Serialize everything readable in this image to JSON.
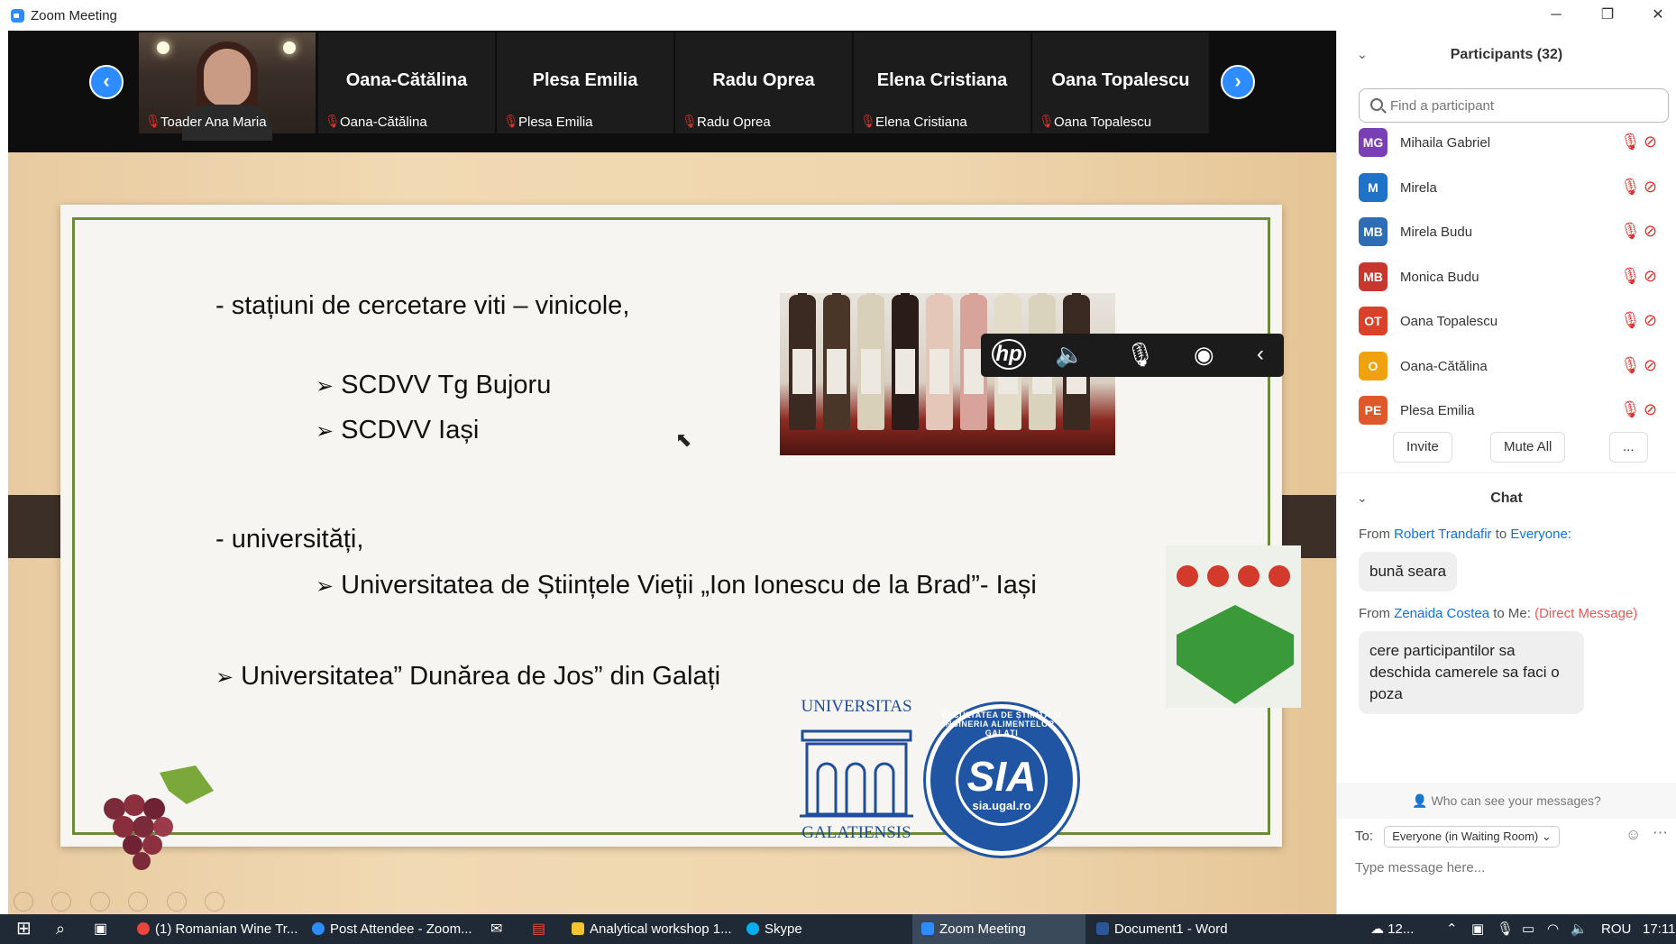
{
  "window": {
    "title": "Zoom Meeting",
    "controls": {
      "minimize": "─",
      "restore": "❐",
      "close": "✕"
    }
  },
  "strip": {
    "prev": "‹",
    "next": "›",
    "tiles": [
      {
        "name": "Toader Ana Maria",
        "big": ""
      },
      {
        "name": "Oana-Cătălina",
        "big": "Oana-Cătălina"
      },
      {
        "name": "Plesa Emilia",
        "big": "Plesa Emilia"
      },
      {
        "name": "Radu Oprea",
        "big": "Radu Oprea"
      },
      {
        "name": "Elena Cristiana",
        "big": "Elena Cristiana"
      },
      {
        "name": "Oana Topalescu",
        "big": "Oana Topalescu"
      }
    ]
  },
  "slide": {
    "bullet1": "-   stațiuni de cercetare viti – vinicole,",
    "sub1": "SCDVV Tg Bujoru",
    "sub2": "SCDVV Iași",
    "bullet2": "-   universități,",
    "sub3": "Universitatea de Științele Vieții „Ion Ionescu de la Brad”- Iași",
    "bullet3": "Universitatea” Dunărea de Jos” din Galați",
    "arrow": "➢",
    "univ_top": "UNIVERSITAS",
    "univ_bottom": "GALATIENSIS",
    "sia_main": "SIA",
    "sia_url": "sia.ugal.ro",
    "sia_ring": "FACULTATEA DE ȘTIINȚA ȘI INGINERIA ALIMENTELOR · GALAȚI",
    "hp": "hp"
  },
  "panel": {
    "participants_title": "Participants (32)",
    "search_placeholder": "Find a participant",
    "participants": [
      {
        "initials": "MG",
        "name": "Mihaila Gabriel",
        "color": "#7b3fb5"
      },
      {
        "initials": "M",
        "name": "Mirela",
        "color": "#1e73c8"
      },
      {
        "initials": "MB",
        "name": "Mirela Budu",
        "color": "#2e6db4"
      },
      {
        "initials": "MB",
        "name": "Monica Budu",
        "color": "#c8372d"
      },
      {
        "initials": "OT",
        "name": "Oana Topalescu",
        "color": "#d9412b"
      },
      {
        "initials": "O",
        "name": "Oana-Cătălina",
        "color": "#f0a10e"
      },
      {
        "initials": "PE",
        "name": "Plesa Emilia",
        "color": "#e0572a"
      }
    ],
    "invite": "Invite",
    "mute_all": "Mute All",
    "more": "...",
    "chat_title": "Chat",
    "messages": [
      {
        "from": "From",
        "sender": "Robert Trandafir",
        "to_word": "to",
        "to": "Everyone:",
        "dm": "",
        "text": "bună seara"
      },
      {
        "from": "From",
        "sender": "Zenaida Costea",
        "to_word": "to Me:",
        "to": "",
        "dm": "(Direct Message)",
        "text": "cere participantilor sa deschida camerele sa faci o poza"
      }
    ],
    "who_can_see": "Who can see your messages?",
    "to_label": "To:",
    "to_value": "Everyone (in Waiting Room)",
    "message_placeholder": "Type message here..."
  },
  "taskbar": {
    "items": [
      {
        "label": "(1) Romanian Wine Tr...",
        "color": "#e8453c"
      },
      {
        "label": "Post Attendee - Zoom...",
        "color": "#2d8cff"
      },
      {
        "label": "Analytical workshop 1...",
        "color": "#f4c430"
      },
      {
        "label": "Skype",
        "color": "#00aff0"
      },
      {
        "label": "Zoom Meeting",
        "color": "#2d8cff"
      },
      {
        "label": "Document1 - Word",
        "color": "#2b579a"
      }
    ],
    "weather": "12...",
    "lang": "ROU",
    "time": "17:11"
  }
}
